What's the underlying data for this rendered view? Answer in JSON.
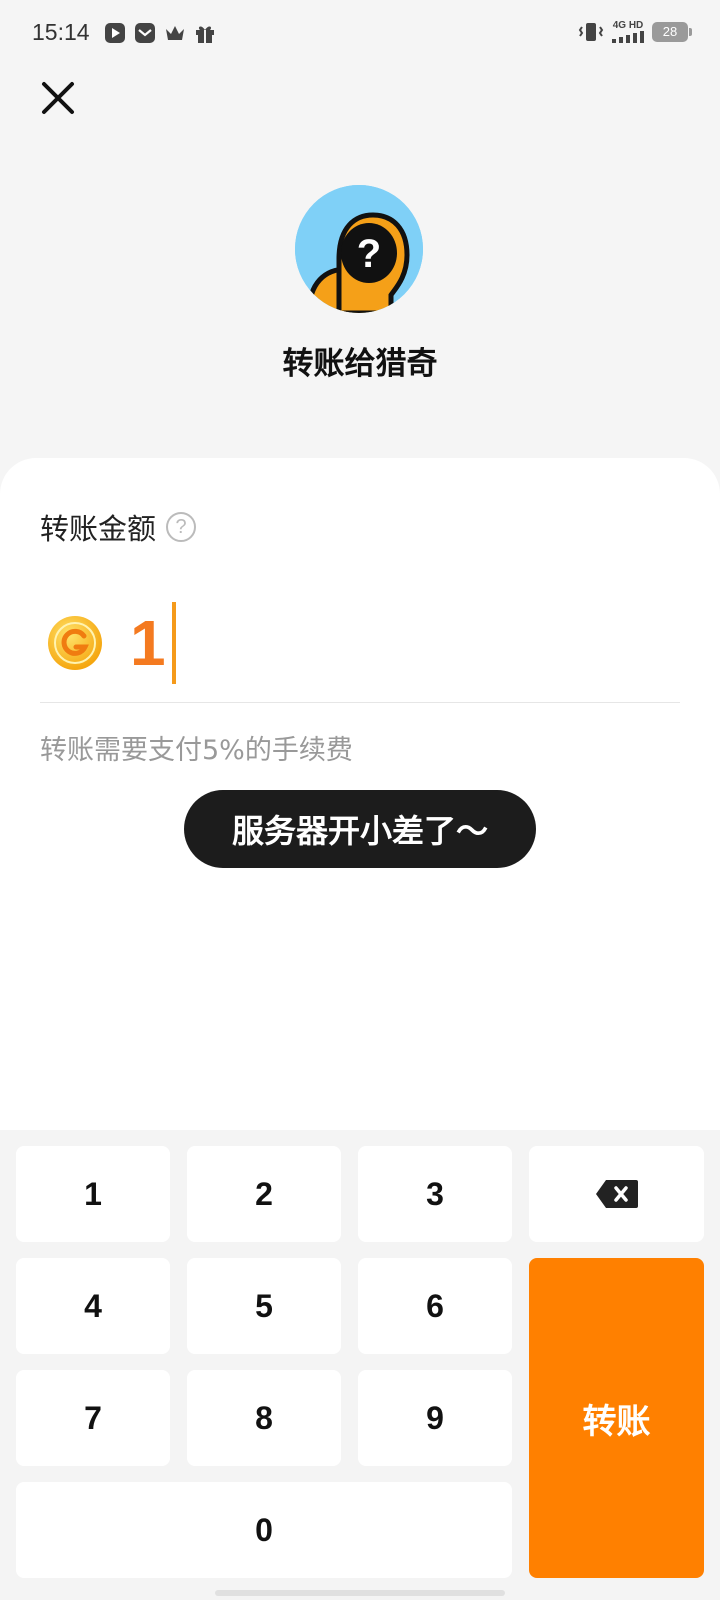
{
  "status_bar": {
    "time": "15:14",
    "network_top": "4G HD",
    "battery": "28",
    "icons": [
      "play-icon",
      "message-icon",
      "crown-icon",
      "gift-icon",
      "vibrate-icon",
      "signal-icon"
    ]
  },
  "header": {
    "close_icon": "close-icon",
    "title": "转账给猎奇"
  },
  "form": {
    "amount_label": "转账金额",
    "help_glyph": "?",
    "amount_value": "1",
    "coin_icon": "coin-icon",
    "fee_note": "转账需要支付5%的手续费"
  },
  "toast": {
    "message": "服务器开小差了～"
  },
  "keypad": {
    "keys": [
      "1",
      "2",
      "3",
      "4",
      "5",
      "6",
      "7",
      "8",
      "9",
      "0"
    ],
    "backspace_icon": "backspace-icon",
    "submit_label": "转账"
  },
  "colors": {
    "accent": "#ff8000",
    "amount": "#f47a20",
    "toast_bg": "#1c1c1c",
    "avatar_bg": "#7fd0f7"
  }
}
